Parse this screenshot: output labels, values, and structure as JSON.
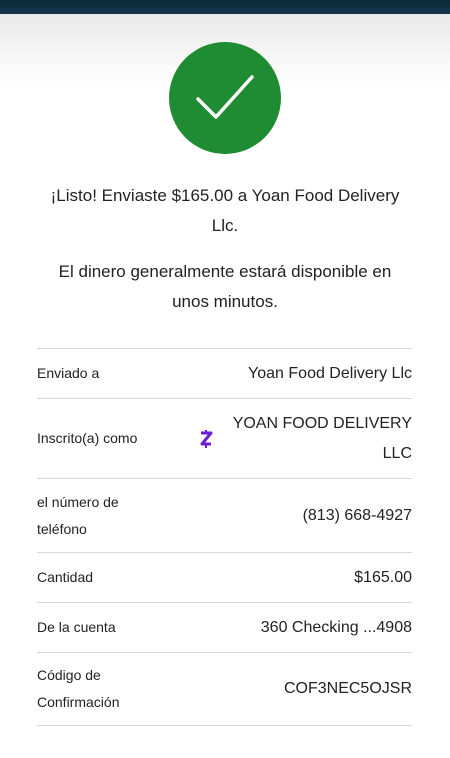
{
  "success": {
    "icon": "checkmark-icon",
    "accent_color": "#1f8b32",
    "sent_message": "¡Listo! Enviaste $165.00 a Yoan Food Delivery Llc.",
    "availability_message": "El dinero generalmente estará disponible en unos minutos."
  },
  "details": {
    "sent_to": {
      "label": "Enviado a",
      "value": "Yoan Food Delivery Llc"
    },
    "enrolled_as": {
      "label": "Inscrito(a) como",
      "value": "YOAN FOOD DELIVERY LLC",
      "icon": "zelle-icon",
      "icon_color": "#6d1ed4"
    },
    "phone": {
      "label": "el número de teléfono",
      "value": "(813) 668-4927"
    },
    "amount": {
      "label": "Cantidad",
      "value": "$165.00"
    },
    "from_account": {
      "label": "De la cuenta",
      "value": "360 Checking ...4908"
    },
    "confirmation": {
      "label": "Código de Confirmación",
      "value": "COF3NEC5OJSR"
    }
  }
}
